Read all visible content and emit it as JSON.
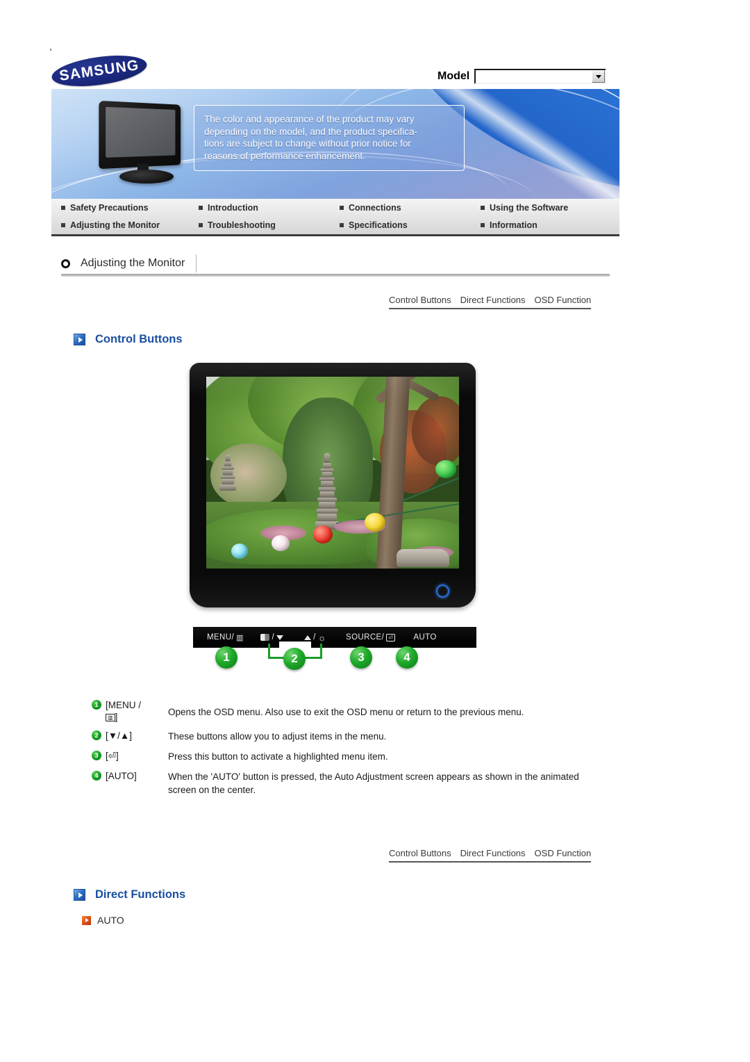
{
  "header": {
    "logo_text": "SAMSUNG",
    "model_label": "Model",
    "model_value": "",
    "model_dropdown_icon": "chevron-down-icon"
  },
  "banner": {
    "notice": "The color and appearance of the product may vary\ndepending on the model, and the product specifica-\ntions are subject to change without prior notice for\nreasons of performance enhancement."
  },
  "nav": {
    "items": [
      {
        "label": "Safety Precautions"
      },
      {
        "label": "Introduction"
      },
      {
        "label": "Connections"
      },
      {
        "label": "Using the Software"
      },
      {
        "label": "Adjusting the Monitor"
      },
      {
        "label": "Troubleshooting"
      },
      {
        "label": "Specifications"
      },
      {
        "label": "Information"
      }
    ]
  },
  "page": {
    "title": "Adjusting the Monitor",
    "title_icon": "ring-icon"
  },
  "subtabs": {
    "items": [
      {
        "label": "Control Buttons"
      },
      {
        "label": "Direct Functions"
      },
      {
        "label": "OSD Function"
      }
    ]
  },
  "sections": {
    "control_buttons": {
      "heading": "Control Buttons",
      "heading_icon": "blue-play-icon"
    },
    "direct_functions": {
      "heading": "Direct Functions",
      "heading_icon": "blue-play-icon",
      "auto_label": "AUTO",
      "auto_icon": "orange-play-icon"
    }
  },
  "monitor": {
    "control_strip": [
      {
        "label": "MENU/",
        "glyph": "menu-bars-icon"
      },
      {
        "label": "/",
        "glyph_before": "contrast-icon",
        "glyph_after": "triangle-down-icon"
      },
      {
        "label": "/",
        "glyph_before": "triangle-up-icon",
        "glyph_after": "brightness-sun-icon"
      },
      {
        "label": "SOURCE/",
        "glyph": "enter-box-icon"
      },
      {
        "label": "AUTO"
      }
    ],
    "callouts": [
      {
        "number": "1"
      },
      {
        "number": "2"
      },
      {
        "number": "3"
      },
      {
        "number": "4"
      }
    ],
    "power_led": "power-led-icon"
  },
  "descriptions": [
    {
      "number": "1",
      "key_prefix": "[MENU /",
      "key_glyph": "menu-bars-icon",
      "key_suffix": "]",
      "text": "Opens the OSD menu. Also use to exit the OSD menu or return to the previous menu."
    },
    {
      "number": "2",
      "key": "[▼/▲]",
      "text": "These buttons allow you to adjust items in the menu."
    },
    {
      "number": "3",
      "key": "[⏎]",
      "text": "Press this button to activate a highlighted menu item."
    },
    {
      "number": "4",
      "key": "[AUTO]",
      "text": "When the 'AUTO' button is pressed, the Auto Adjustment screen appears as shown in the animated screen on the center."
    }
  ],
  "colors": {
    "brand_blue": "#1c2a80",
    "heading_blue": "#1a4fa0",
    "accent_orange": "#de4f18",
    "callout_green": "#1faa2a"
  }
}
